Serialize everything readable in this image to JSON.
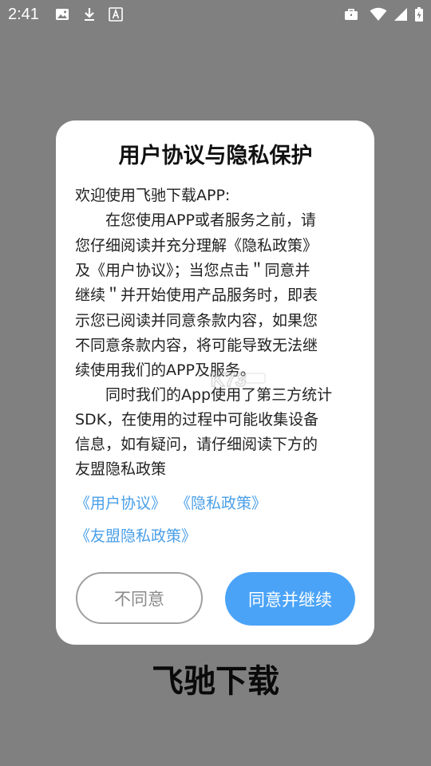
{
  "status_bar": {
    "time": "2:41",
    "left_icons": [
      "image-icon",
      "download-icon",
      "font-icon"
    ],
    "right_icons": [
      "briefcase-icon",
      "wifi-icon",
      "signal-icon",
      "battery-icon"
    ]
  },
  "dialog": {
    "title": "用户协议与隐私保护",
    "lines": [
      "欢迎使用飞驰下载APP:",
      "　　在您使用APP或者服务之前，请",
      "您仔细阅读并充分理解《隐私政策》",
      "及《用户协议》；当您点击＂同意并",
      "继续＂并开始使用产品服务时，即表",
      "示您已阅读并同意条款内容，如果您",
      "不同意条款内容，将可能导致无法继",
      "续使用我们的APP及服务。",
      "　　同时我们的App使用了第三方统计",
      "SDK，在使用的过程中可能收集设备",
      "信息，如有疑问，请仔细阅读下方的",
      "友盟隐私政策"
    ],
    "link_user_agreement": "《用户协议》",
    "link_privacy_policy": "《隐私政策》",
    "link_umeng_privacy": "《友盟隐私政策》",
    "decline_label": "不同意",
    "accept_label": "同意并继续"
  },
  "app_name": "飞驰下载",
  "colors": {
    "overlay": "#808080",
    "accent": "#4aa3f7",
    "link": "#4a9fe8"
  }
}
